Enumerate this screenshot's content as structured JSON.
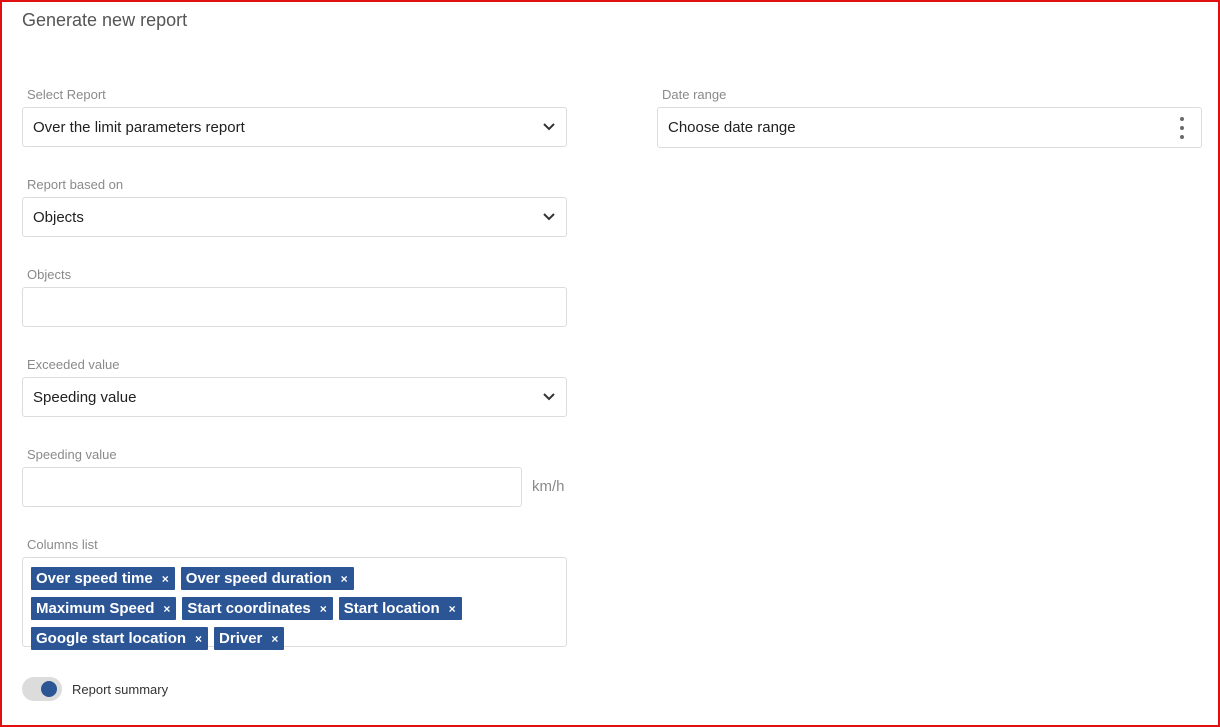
{
  "header": {
    "title": "Generate new report"
  },
  "select_report": {
    "label": "Select Report",
    "value": "Over the limit parameters report"
  },
  "date_range": {
    "label": "Date range",
    "value": "Choose date range"
  },
  "report_based_on": {
    "label": "Report based on",
    "value": "Objects"
  },
  "objects": {
    "label": "Objects",
    "value": ""
  },
  "exceeded_value": {
    "label": "Exceeded value",
    "value": "Speeding value"
  },
  "speeding_value": {
    "label": "Speeding value",
    "value": "",
    "unit": "km/h"
  },
  "columns_list": {
    "label": "Columns list",
    "tags": [
      "Over speed time",
      "Over speed duration",
      "Maximum Speed",
      "Start coordinates",
      "Start location",
      "Google start location",
      "Driver"
    ],
    "remove_glyph": "×"
  },
  "report_summary": {
    "label": "Report summary",
    "enabled": true
  },
  "colors": {
    "frame_border": "#e01010",
    "tag_bg": "#2c5595",
    "toggle_knob": "#2c5595"
  }
}
